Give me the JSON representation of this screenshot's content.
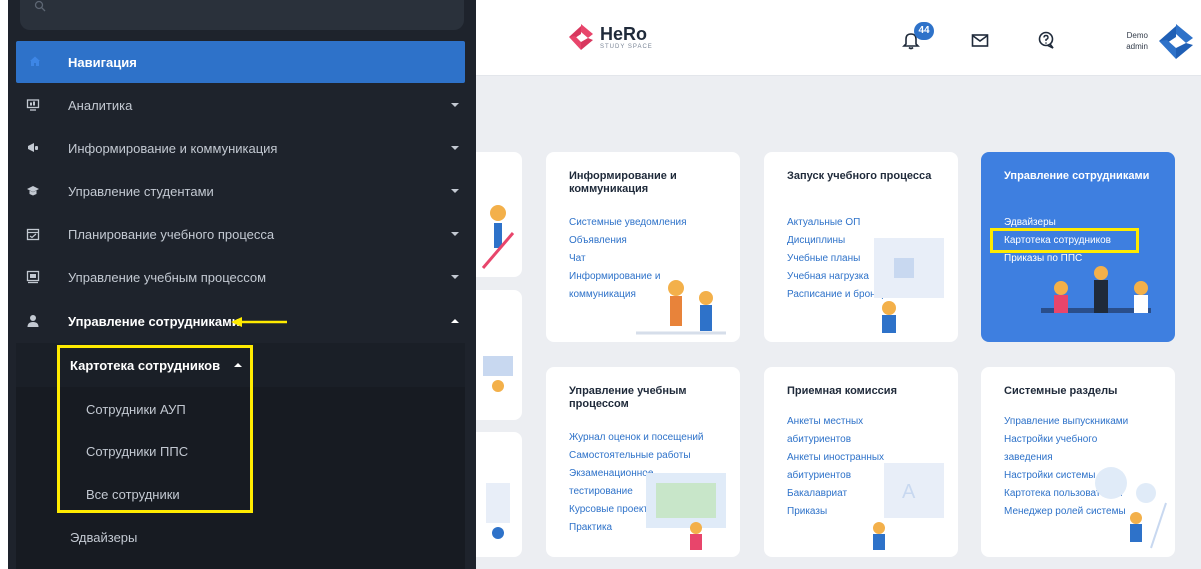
{
  "sidebar": {
    "header": {
      "label": "Навигация",
      "icon": "home-icon"
    },
    "items": [
      {
        "label": "Аналитика",
        "icon": "monitor-icon"
      },
      {
        "label": "Информирование и коммуникация",
        "icon": "megaphone-icon"
      },
      {
        "label": "Управление студентами",
        "icon": "graduation-cap-icon"
      },
      {
        "label": "Планирование учебного процесса",
        "icon": "calendar-icon"
      },
      {
        "label": "Управление учебным процессом",
        "icon": "board-icon"
      },
      {
        "label": "Управление сотрудниками",
        "icon": "user-icon",
        "active": true
      }
    ],
    "submenu": {
      "header": "Картотека сотрудников",
      "items": [
        "Сотрудники АУП",
        "Сотрудники ППС",
        "Все сотрудники"
      ],
      "next": "Эдвайзеры"
    }
  },
  "topbar": {
    "logo_name": "HeRo",
    "logo_sub": "STUDY SPACE",
    "notifications_count": "44",
    "user_line1": "Demo",
    "user_line2": "admin"
  },
  "cards": [
    {
      "title": "Информирование и коммуникация",
      "links": [
        "Системные уведомления",
        "Объявления",
        "Чат",
        "Информирование и",
        "коммуникация"
      ]
    },
    {
      "title": "Запуск учебного процесса",
      "links": [
        "Актуальные ОП",
        "Дисциплины",
        "Учебные планы",
        "Учебная нагрузка",
        "Расписание и бронирование"
      ]
    },
    {
      "title": "Управление сотрудниками",
      "links": [
        "Эдвайзеры",
        "Картотека сотрудников",
        "Приказы по ППС"
      ]
    },
    {
      "title": "Управление учебным процессом",
      "links": [
        "Журнал оценок и посещений",
        "Самостоятельные работы",
        "Экзаменационное",
        "тестирование",
        "Курсовые проекты",
        "Практика"
      ]
    },
    {
      "title": "Приемная комиссия",
      "links": [
        "Анкеты местных",
        "абитуриентов",
        "Анкеты иностранных",
        "абитуриентов",
        "Бакалавриат",
        "Приказы"
      ]
    },
    {
      "title": "Системные разделы",
      "links": [
        "Управление выпускниками",
        "Настройки учебного",
        "заведения",
        "Настройки системы",
        "Картотека пользователей",
        "Менеджер ролей системы"
      ]
    }
  ],
  "colors": {
    "sidebar_bg": "#1e232c",
    "accent": "#2e72c9",
    "highlight": "#ffeb00",
    "card_blue": "#3e7fe0"
  }
}
